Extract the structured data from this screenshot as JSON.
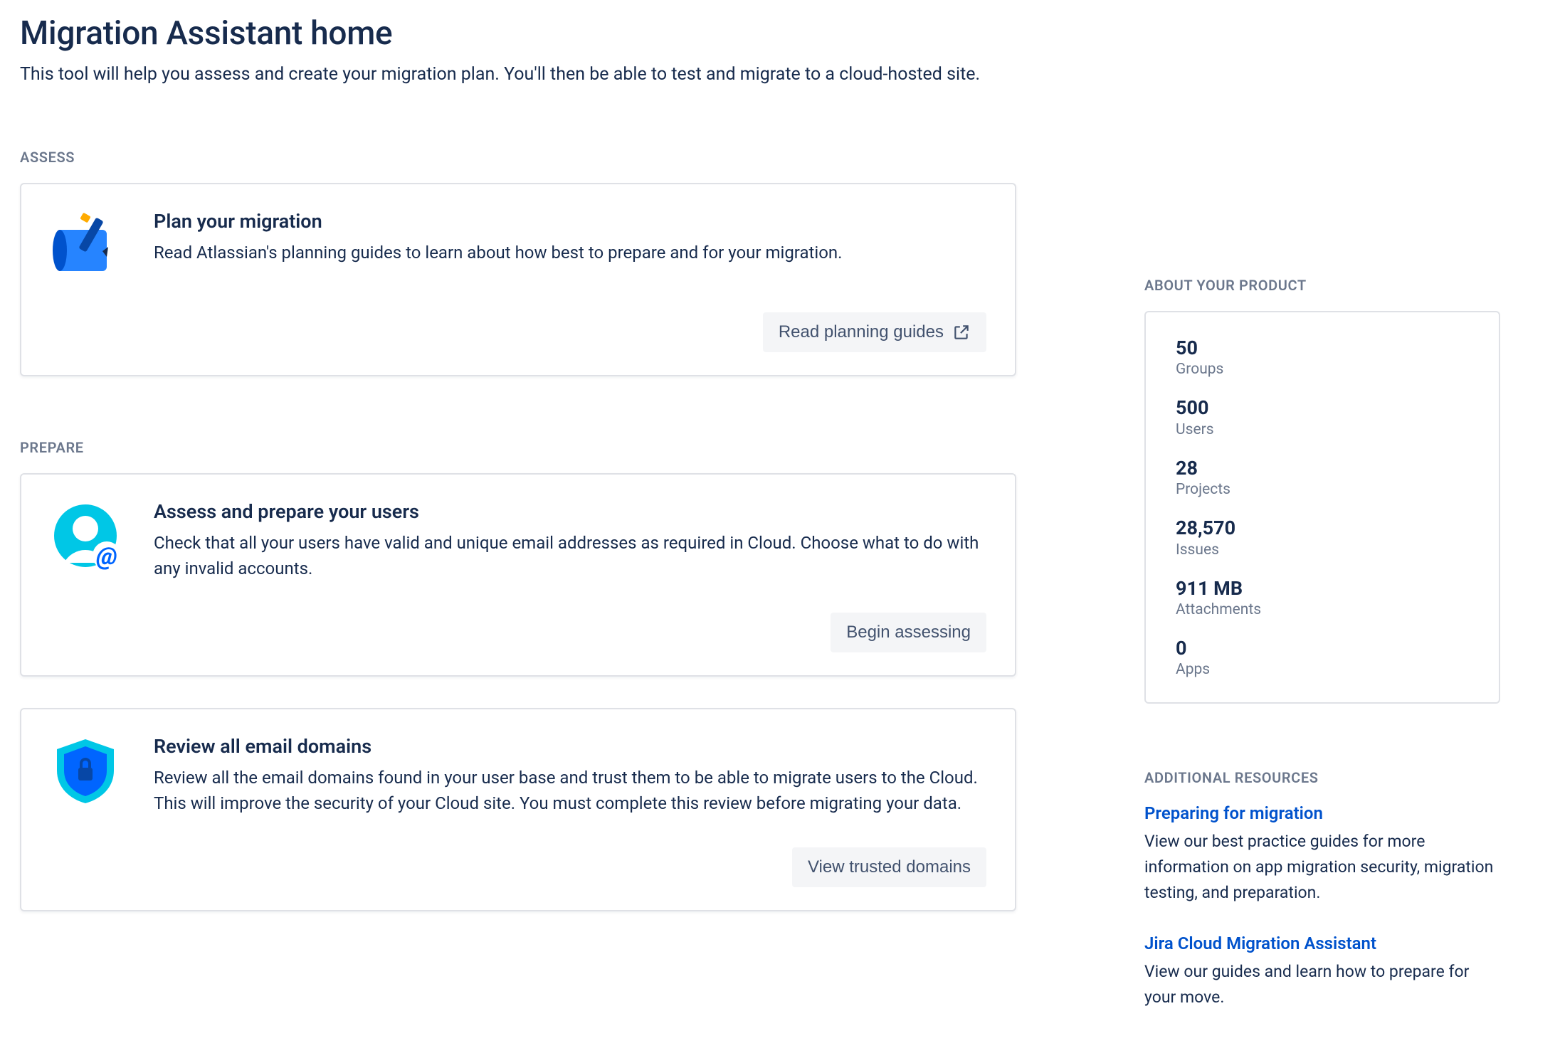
{
  "page": {
    "title": "Migration Assistant home",
    "subtitle": "This tool will help you assess and create your migration plan. You'll then be able to test and migrate to a cloud-hosted site."
  },
  "sections": {
    "assess_label": "ASSESS",
    "prepare_label": "PREPARE",
    "about_label": "ABOUT YOUR PRODUCT",
    "resources_label": "ADDITIONAL RESOURCES"
  },
  "cards": {
    "plan": {
      "title": "Plan your migration",
      "desc": "Read Atlassian's planning guides to learn about how best to prepare and for your migration.",
      "button": "Read planning guides"
    },
    "users": {
      "title": "Assess and prepare your users",
      "desc": "Check that all your users have valid and unique email addresses as required in Cloud. Choose what to do with any invalid accounts.",
      "button": "Begin assessing"
    },
    "domains": {
      "title": "Review all email domains",
      "desc": "Review all the email domains found in your user base and trust them to be able to migrate users to the Cloud. This will improve the security of your Cloud site. You must complete this review before migrating your data.",
      "button": "View trusted domains"
    }
  },
  "stats": {
    "groups": {
      "value": "50",
      "label": "Groups"
    },
    "users": {
      "value": "500",
      "label": "Users"
    },
    "projects": {
      "value": "28",
      "label": "Projects"
    },
    "issues": {
      "value": "28,570",
      "label": "Issues"
    },
    "attachments": {
      "value": "911 MB",
      "label": "Attachments"
    },
    "apps": {
      "value": "0",
      "label": "Apps"
    }
  },
  "resources": {
    "prep": {
      "title": "Preparing for migration",
      "desc": "View our best practice guides for more information on app migration security, migration testing, and preparation."
    },
    "jcma": {
      "title": "Jira Cloud Migration Assistant",
      "desc": "View our guides and learn how to prepare for your move."
    }
  }
}
